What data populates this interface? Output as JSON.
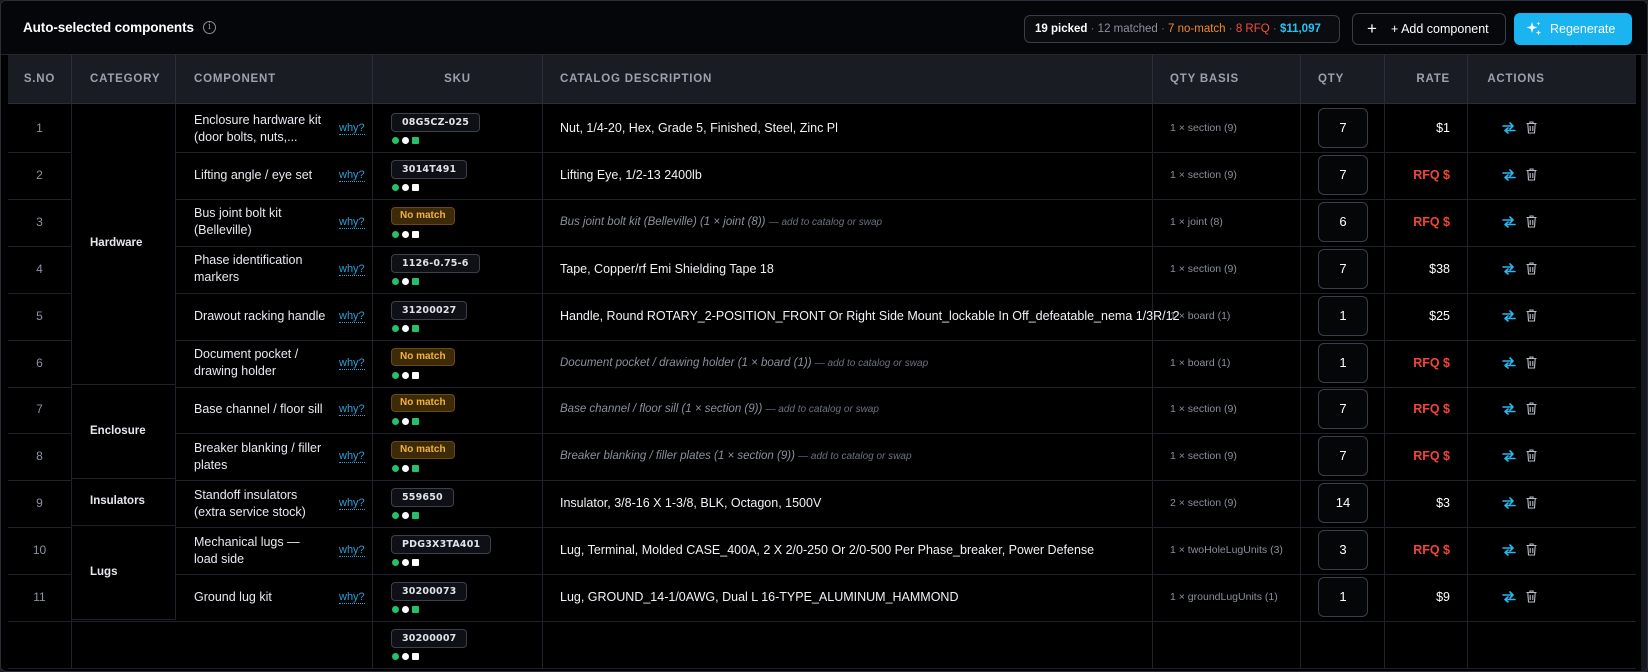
{
  "header": {
    "title": "Auto-selected components",
    "stats": {
      "picked": "19 picked",
      "matched": "12 matched",
      "no_match": "7 no-match",
      "rfq": "8 RFQ",
      "cost": "$11,097",
      "sep": "·"
    },
    "add_component_label": "+ Add component",
    "add_plus": "+",
    "regenerate_label": "Regenerate"
  },
  "columns": {
    "sno": "S.NO",
    "category": "CATEGORY",
    "component": "COMPONENT",
    "sku": "SKU",
    "description": "CATALOG DESCRIPTION",
    "qty_basis": "QTY BASIS",
    "qty": "QTY",
    "rate": "RATE",
    "actions": "ACTIONS"
  },
  "categories": {
    "hardware": "Hardware",
    "enclosure": "Enclosure",
    "insulators": "Insulators",
    "lugs": "Lugs"
  },
  "why_label": "why?",
  "no_match_label": "No match",
  "rows": [
    {
      "sno": "1",
      "component": "Enclosure hardware kit (door bolts, nuts,...",
      "sku": "08G5CZ-025",
      "desc": "Nut, 1/4-20, Hex, Grade 5, Finished, Steel, Zinc Pl",
      "desc_hint": "",
      "basis": "1 × section (9)",
      "qty": "7",
      "rate": "$1"
    },
    {
      "sno": "2",
      "component": "Lifting angle / eye set",
      "sku": "3014T491",
      "desc": "Lifting Eye, 1/2-13 2400lb",
      "desc_hint": "",
      "basis": "1 × section (9)",
      "qty": "7",
      "rate": "RFQ $"
    },
    {
      "sno": "3",
      "component": "Bus joint bolt kit (Belleville)",
      "sku": "",
      "desc": "Bus joint bolt kit (Belleville) (1 × joint (8))",
      "desc_hint": "— add to catalog or swap",
      "basis": "1 × joint (8)",
      "qty": "6",
      "rate": "RFQ $"
    },
    {
      "sno": "4",
      "component": "Phase identification markers",
      "sku": "1126-0.75-6",
      "desc": "Tape, Copper/rf Emi Shielding Tape 18",
      "desc_hint": "",
      "basis": "1 × section (9)",
      "qty": "7",
      "rate": "$38"
    },
    {
      "sno": "5",
      "component": "Drawout racking handle",
      "sku": "31200027",
      "desc": "Handle, Round ROTARY_2-POSITION_FRONT Or Right Side Mount_lockable In Off_defeatable_nema 1/3R/12",
      "desc_hint": "",
      "basis": "1 × board (1)",
      "qty": "1",
      "rate": "$25"
    },
    {
      "sno": "6",
      "component": "Document pocket / drawing holder",
      "sku": "",
      "desc": "Document pocket / drawing holder (1 × board (1))",
      "desc_hint": "— add to catalog or swap",
      "basis": "1 × board (1)",
      "qty": "1",
      "rate": "RFQ $"
    },
    {
      "sno": "7",
      "component": "Base channel / floor sill",
      "sku": "",
      "desc": "Base channel / floor sill (1 × section (9))",
      "desc_hint": "— add to catalog or swap",
      "basis": "1 × section (9)",
      "qty": "7",
      "rate": "RFQ $"
    },
    {
      "sno": "8",
      "component": "Breaker blanking / filler plates",
      "sku": "",
      "desc": "Breaker blanking / filler plates (1 × section (9))",
      "desc_hint": "— add to catalog or swap",
      "basis": "1 × section (9)",
      "qty": "7",
      "rate": "RFQ $"
    },
    {
      "sno": "9",
      "component": "Standoff insulators (extra service stock)",
      "sku": "559650",
      "desc": "Insulator, 3/8-16 X 1-3/8, BLK, Octagon, 1500V",
      "desc_hint": "",
      "basis": "2 × section (9)",
      "qty": "14",
      "rate": "$3"
    },
    {
      "sno": "10",
      "component": "Mechanical lugs — load side",
      "sku": "PDG3X3TA401",
      "desc": "Lug, Terminal, Molded CASE_400A, 2 X 2/0-250 Or 2/0-500 Per Phase_breaker, Power Defense",
      "desc_hint": "",
      "basis": "1 × twoHoleLugUnits (3)",
      "qty": "3",
      "rate": "RFQ $"
    },
    {
      "sno": "11",
      "component": "Ground lug kit",
      "sku": "30200073",
      "desc": "Lug, GROUND_14-1/0AWG, Dual L 16-TYPE_ALUMINUM_HAMMOND",
      "desc_hint": "",
      "basis": "1 × groundLugUnits (1)",
      "qty": "1",
      "rate": "$9"
    },
    {
      "sno": "",
      "component": "",
      "sku": "30200007",
      "desc": "",
      "desc_hint": "",
      "basis": "",
      "qty": "",
      "rate": ""
    }
  ]
}
